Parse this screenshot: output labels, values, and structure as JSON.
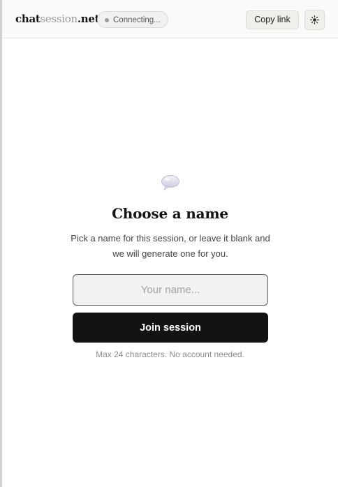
{
  "header": {
    "brand": {
      "part1": "chat",
      "part2": "session",
      "part3": ".net"
    },
    "status": "Connecting...",
    "copy_link_label": "Copy link",
    "theme_icon": "sun-icon"
  },
  "main": {
    "icon": "chat-bubble-icon",
    "title": "Choose a name",
    "subtitle": "Pick a name for this session, or leave it blank and we will generate one for you.",
    "name_input": {
      "value": "",
      "placeholder": "Your name..."
    },
    "join_label": "Join session",
    "hint": "Max 24 characters. No account needed."
  },
  "colors": {
    "primary_button": "#141312",
    "page_background": "#ffffff",
    "header_background": "#fafafa"
  }
}
